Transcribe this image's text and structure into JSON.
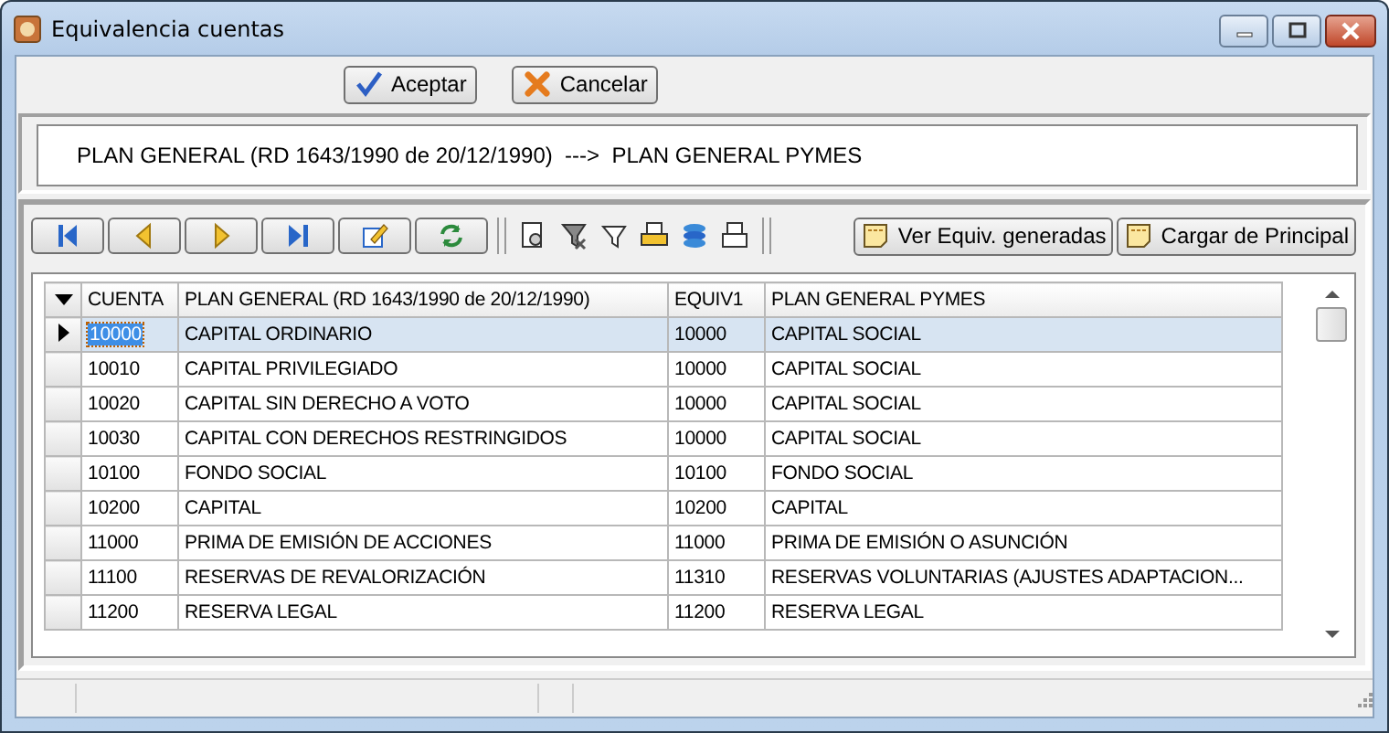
{
  "window": {
    "title": "Equivalencia cuentas"
  },
  "buttons": [
    {
      "kind": "accept",
      "label": "Aceptar"
    },
    {
      "kind": "cancel",
      "label": "Cancelar"
    }
  ],
  "header": {
    "text": "PLAN GENERAL (RD 1643/1990 de 20/12/1990)  --->  PLAN GENERAL PYMES"
  },
  "toolbar": {
    "buttons": [
      {
        "label": "Ver Equiv. generadas"
      },
      {
        "label": "Cargar de Principal"
      }
    ]
  },
  "table": {
    "columns": [
      "CUENTA",
      "PLAN GENERAL (RD 1643/1990 de 20/12/1990)",
      "EQUIV1",
      "PLAN GENERAL PYMES"
    ],
    "rows": [
      {
        "cells": [
          "10000",
          "CAPITAL ORDINARIO",
          "10000",
          "CAPITAL SOCIAL"
        ],
        "selected": true
      },
      {
        "cells": [
          "10010",
          "CAPITAL PRIVILEGIADO",
          "10000",
          "CAPITAL SOCIAL"
        ],
        "selected": false
      },
      {
        "cells": [
          "10020",
          "CAPITAL SIN DERECHO A VOTO",
          "10000",
          "CAPITAL SOCIAL"
        ],
        "selected": false
      },
      {
        "cells": [
          "10030",
          "CAPITAL CON DERECHOS RESTRINGIDOS",
          "10000",
          "CAPITAL SOCIAL"
        ],
        "selected": false
      },
      {
        "cells": [
          "10100",
          "FONDO SOCIAL",
          "10100",
          "FONDO SOCIAL"
        ],
        "selected": false
      },
      {
        "cells": [
          "10200",
          "CAPITAL",
          "10200",
          "CAPITAL"
        ],
        "selected": false
      },
      {
        "cells": [
          "11000",
          "PRIMA DE EMISIÓN DE ACCIONES",
          "11000",
          "PRIMA DE EMISIÓN O ASUNCIÓN"
        ],
        "selected": false
      },
      {
        "cells": [
          "11100",
          "RESERVAS DE REVALORIZACIÓN",
          "11310",
          "RESERVAS VOLUNTARIAS (AJUSTES ADAPTACION..."
        ],
        "selected": false
      },
      {
        "cells": [
          "11200",
          "RESERVA LEGAL",
          "11200",
          "RESERVA LEGAL"
        ],
        "selected": false
      }
    ]
  }
}
